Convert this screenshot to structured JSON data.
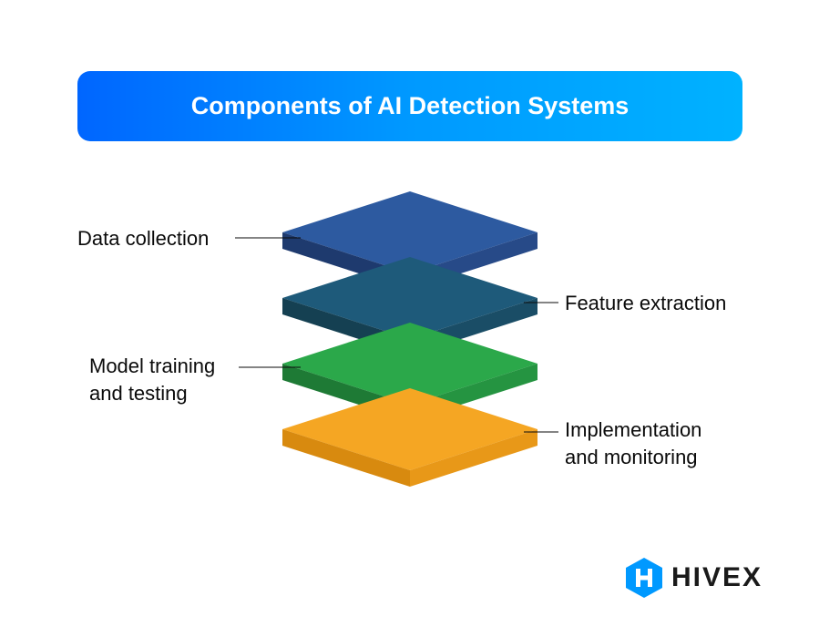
{
  "title": "Components of AI Detection Systems",
  "layers": [
    {
      "label": "Data collection",
      "side": "left",
      "color_top": "#2d5aa0",
      "color_left": "#1e3a6e",
      "color_right": "#274a88"
    },
    {
      "label": "Feature extraction",
      "side": "right",
      "color_top": "#1e5a7a",
      "color_left": "#154052",
      "color_right": "#1a4d66"
    },
    {
      "label": "Model training\nand testing",
      "side": "left",
      "color_top": "#2ba84a",
      "color_left": "#1e7a35",
      "color_right": "#259441"
    },
    {
      "label": "Implementation\nand monitoring",
      "side": "right",
      "color_top": "#f5a623",
      "color_left": "#d88a0f",
      "color_right": "#e89818"
    }
  ],
  "brand": {
    "name": "HIVEX",
    "accent_color": "#0099FF"
  }
}
